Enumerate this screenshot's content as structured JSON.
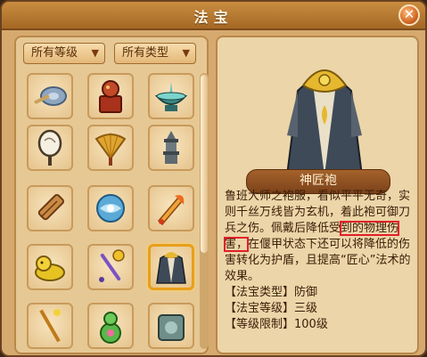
{
  "window": {
    "title": "法宝",
    "close_label": "✕"
  },
  "filters": {
    "level": "所有等级",
    "type": "所有类型"
  },
  "items": [
    {
      "name": "disc"
    },
    {
      "name": "seal"
    },
    {
      "name": "basin"
    },
    {
      "name": "mirror"
    },
    {
      "name": "fan"
    },
    {
      "name": "pagoda"
    },
    {
      "name": "scroll"
    },
    {
      "name": "orb"
    },
    {
      "name": "sword"
    },
    {
      "name": "lion"
    },
    {
      "name": "staff"
    },
    {
      "name": "robe"
    },
    {
      "name": "rod"
    },
    {
      "name": "gourd"
    },
    {
      "name": "jade"
    }
  ],
  "selected_index": 11,
  "detail": {
    "name": "神匠袍",
    "desc_before": "鲁班大师之袍服，看似平平无奇，实则千丝万线皆为玄机，着此袍可御刀兵之伤。佩戴后降低受",
    "desc_highlight": "到的物理伤害，",
    "desc_after": "在偃甲状态下还可以将降低的伤害转化为护盾，且提高“匠心”法术的效果。",
    "attrs": [
      "【法宝类型】防御",
      "【法宝等级】三级",
      "【等级限制】100级"
    ]
  },
  "colors": {
    "highlight_border": "#e0202a",
    "accent": "#e89f1a"
  }
}
